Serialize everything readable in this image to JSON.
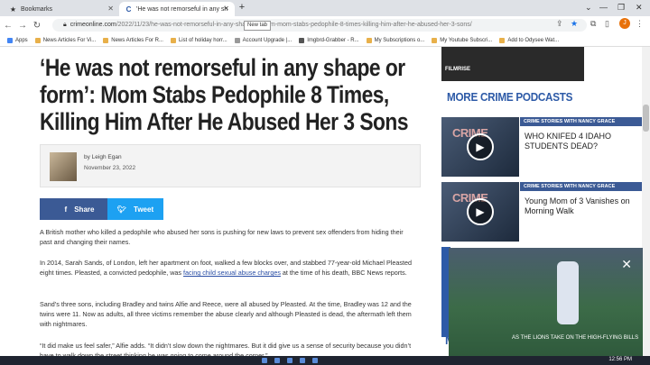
{
  "browser": {
    "tabs": [
      {
        "label": "Bookmarks",
        "icon": "star-icon"
      },
      {
        "label": "'He was not remorseful in any sh",
        "icon": "site-favicon"
      }
    ],
    "new_tab_tooltip": "New tab",
    "url_domain": "crimeonline.com",
    "url_path": "/2022/11/23/he-was-not-remorseful-in-any-shape-or-form-mom-stabs-pedophile-8-times-killing-him-after-he-abused-her-3-sons/",
    "profile_initial": "J"
  },
  "bookmarks": [
    {
      "label": "Apps"
    },
    {
      "label": "News Articles For Vi..."
    },
    {
      "label": "News Articles For R..."
    },
    {
      "label": "List of holiday horr..."
    },
    {
      "label": "Account Upgrade |..."
    },
    {
      "label": "Imgbrd-Grabber - R..."
    },
    {
      "label": "My Subscriptions o..."
    },
    {
      "label": "My Youtube Subscri..."
    },
    {
      "label": "Add to Odysee Wat..."
    }
  ],
  "article": {
    "headline": "‘He was not remorseful in any shape or form’: Mom Stabs Pedophile 8 Times, Killing Him After He Abused Her 3 Sons",
    "author": "by Leigh Egan",
    "date": "November 23, 2022",
    "share_label": "Share",
    "tweet_label": "Tweet",
    "p1": "A British mother who killed a pedophile who abused her sons is pushing for new laws to prevent sex offenders from hiding their past and changing their names.",
    "p2_a": "In 2014, Sarah Sands, of London, left her apartment on foot, walked a few blocks over, and stabbed 77-year-old Michael Pleasted eight times. Pleasted, a convicted pedophile, was ",
    "p2_link": "facing child sexual abuse charges",
    "p2_b": " at the time of his death, BBC News reports.",
    "p3": "Sand’s three sons, including Bradley and twins Alfie and Reece, were all abused by Pleasted. At the time, Bradley was 12 and the twins were 11. Now as adults, all three victims remember the abuse clearly and although Pleasted is dead, the aftermath left them with nightmares.",
    "p4": "“It did make us feel safer,” Alfie adds. “It didn’t slow down the nightmares. But it did give us a sense of security because you didn’t have to walk down the street thinking he was going to come around the corner.”"
  },
  "sidebar": {
    "filmrise_label": "FILMRISE",
    "section_title": "MORE CRIME PODCASTS",
    "podcasts": [
      {
        "tag": "CRIME STORIES WITH NANCY GRACE",
        "title": "WHO KNIFED 4 IDAHO STUDENTS DEAD?",
        "thumb_text": "CRIME"
      },
      {
        "tag": "CRIME STORIES WITH NANCY GRACE",
        "title": "Young Mom of 3 Vanishes on Morning Walk",
        "thumb_text": "CRIME"
      }
    ],
    "cut_letter": "M"
  },
  "video": {
    "caption": "AS THE LIONS TAKE ON THE HIGH-FLYING BILLS"
  },
  "taskbar": {
    "time": "12:56 PM"
  }
}
